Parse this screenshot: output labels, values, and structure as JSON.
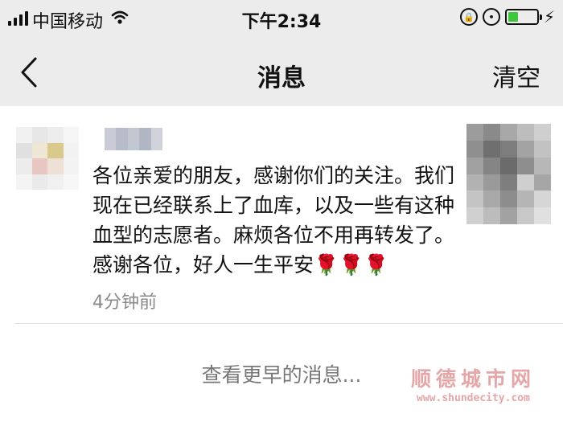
{
  "status_bar": {
    "carrier": "中国移动",
    "time": "下午2:34",
    "icons": [
      "signal-icon",
      "wifi-icon",
      "rotation-lock-icon",
      "alarm-icon",
      "battery-icon",
      "charging-icon"
    ],
    "battery_level": 0.35
  },
  "nav": {
    "back_icon": "chevron-left-icon",
    "title": "消息",
    "clear_label": "清空"
  },
  "message": {
    "text": "各位亲爱的朋友，感谢你们的关注。我们现在已经联系上了血库，以及一些有这种血型的志愿者。麻烦各位不用再转发了。感谢各位，好人一生平安🌹🌹🌹",
    "time": "4分钟前"
  },
  "footer": {
    "more_label": "查看更早的消息..."
  },
  "watermark": {
    "title": "顺德城市网",
    "url": "www.shundecity.com"
  },
  "colors": {
    "header_bg": "#ececec",
    "battery_fill": "#3ec73e",
    "watermark": "#e4a6a6"
  }
}
